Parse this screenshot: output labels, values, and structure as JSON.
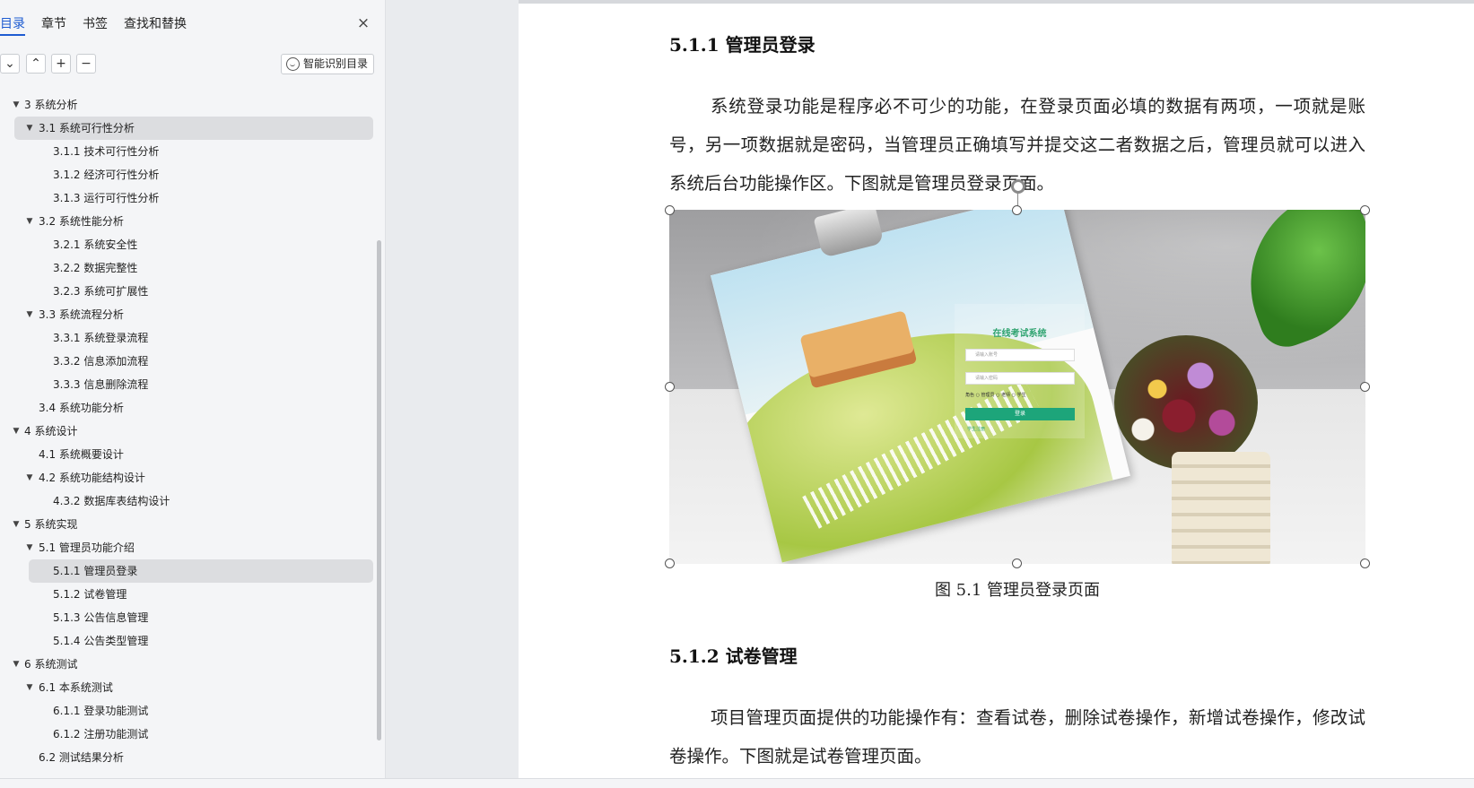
{
  "nav": {
    "tabs": [
      {
        "label": "目录",
        "active": true
      },
      {
        "label": "章节"
      },
      {
        "label": "书签"
      },
      {
        "label": "查找和替换"
      }
    ],
    "close_icon": "×",
    "tools": {
      "collapse_icon": "⌄",
      "expand_icon": "⌃",
      "add_icon": "+",
      "remove_icon": "−",
      "smart_label": "智能识别目录"
    },
    "toc": [
      {
        "label": "3  系统分析",
        "level": 1,
        "arrow": "▼"
      },
      {
        "label": "3.1 系统可行性分析",
        "level": 2,
        "arrow": "▼",
        "selected": true
      },
      {
        "label": "3.1.1  技术可行性分析",
        "level": 3
      },
      {
        "label": "3.1.2  经济可行性分析",
        "level": 3
      },
      {
        "label": "3.1.3  运行可行性分析",
        "level": 3
      },
      {
        "label": "3.2 系统性能分析",
        "level": 2,
        "arrow": "▼"
      },
      {
        "label": "3.2.1  系统安全性",
        "level": 3
      },
      {
        "label": "3.2.2  数据完整性",
        "level": 3
      },
      {
        "label": "3.2.3 系统可扩展性",
        "level": 3
      },
      {
        "label": "3.3 系统流程分析",
        "level": 2,
        "arrow": "▼"
      },
      {
        "label": "3.3.1 系统登录流程",
        "level": 3
      },
      {
        "label": "3.3.2 信息添加流程",
        "level": 3
      },
      {
        "label": "3.3.3 信息删除流程",
        "level": 3
      },
      {
        "label": "3.4 系统功能分析",
        "level": 2
      },
      {
        "label": "4  系统设计",
        "level": 1,
        "arrow": "▼"
      },
      {
        "label": "4.1 系统概要设计",
        "level": 2
      },
      {
        "label": "4.2 系统功能结构设计",
        "level": 2,
        "arrow": "▼"
      },
      {
        "label": "4.3.2  数据库表结构设计",
        "level": 3
      },
      {
        "label": "5  系统实现",
        "level": 1,
        "arrow": "▼"
      },
      {
        "label": "5.1 管理员功能介绍",
        "level": 2,
        "arrow": "▼"
      },
      {
        "label": "5.1.1 管理员登录",
        "level": 3,
        "current": true
      },
      {
        "label": "5.1.2  试卷管理",
        "level": 3
      },
      {
        "label": "5.1.3  公告信息管理",
        "level": 3
      },
      {
        "label": "5.1.4 公告类型管理",
        "level": 3
      },
      {
        "label": "6 系统测试",
        "level": 1,
        "arrow": "▼"
      },
      {
        "label": "6.1  本系统测试",
        "level": 2,
        "arrow": "▼"
      },
      {
        "label": "6.1.1  登录功能测试",
        "level": 3
      },
      {
        "label": "6.1.2  注册功能测试",
        "level": 3
      },
      {
        "label": "6.2 测试结果分析",
        "level": 2
      }
    ]
  },
  "document": {
    "heading_1": "5.1.1 管理员登录",
    "para_1": "系统登录功能是程序必不可少的功能，在登录页面必填的数据有两项，一项就是账号，另一项数据就是密码，当管理员正确填写并提交这二者数据之后，管理员就可以进入系统后台功能操作区。下图就是管理员登录页面。",
    "figure": {
      "login_title": "在线考试系统",
      "username_placeholder": "请输入账号",
      "password_placeholder": "请输入密码",
      "roles": "角色  ○ 管理员  ○ 老师  ○ 学生",
      "login_button": "登录",
      "register_link": "学生注册"
    },
    "caption": "图 5.1  管理员登录页面",
    "heading_2": "5.1.2  试卷管理",
    "para_2": "项目管理页面提供的功能操作有：查看试卷，删除试卷操作，新增试卷操作，修改试卷操作。下图就是试卷管理页面。"
  },
  "colors": {
    "accent": "#1d5bd1",
    "selected_row": "#dcdde0",
    "login_green": "#1da57a"
  }
}
